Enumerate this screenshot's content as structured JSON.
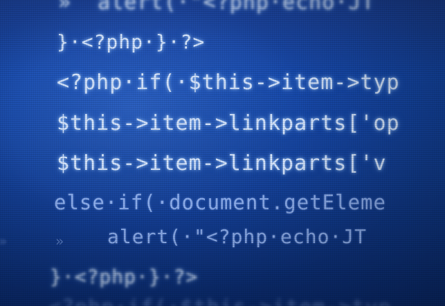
{
  "code_lines": [
    "»  alert(·\"<?php·echo·JT",
    "}·<?php·}·?>",
    "<?php·if(·$this->item->typ",
    "$this->item->linkparts['op",
    "$this->item->linkparts['v",
    "else·if(·document.getEleme",
    "alert(·\"<?php·echo·JT",
    "}·<?php·}·?>",
    "<?php·if(·$this->item->typ"
  ],
  "indent_markers": [
    "»",
    "»"
  ]
}
